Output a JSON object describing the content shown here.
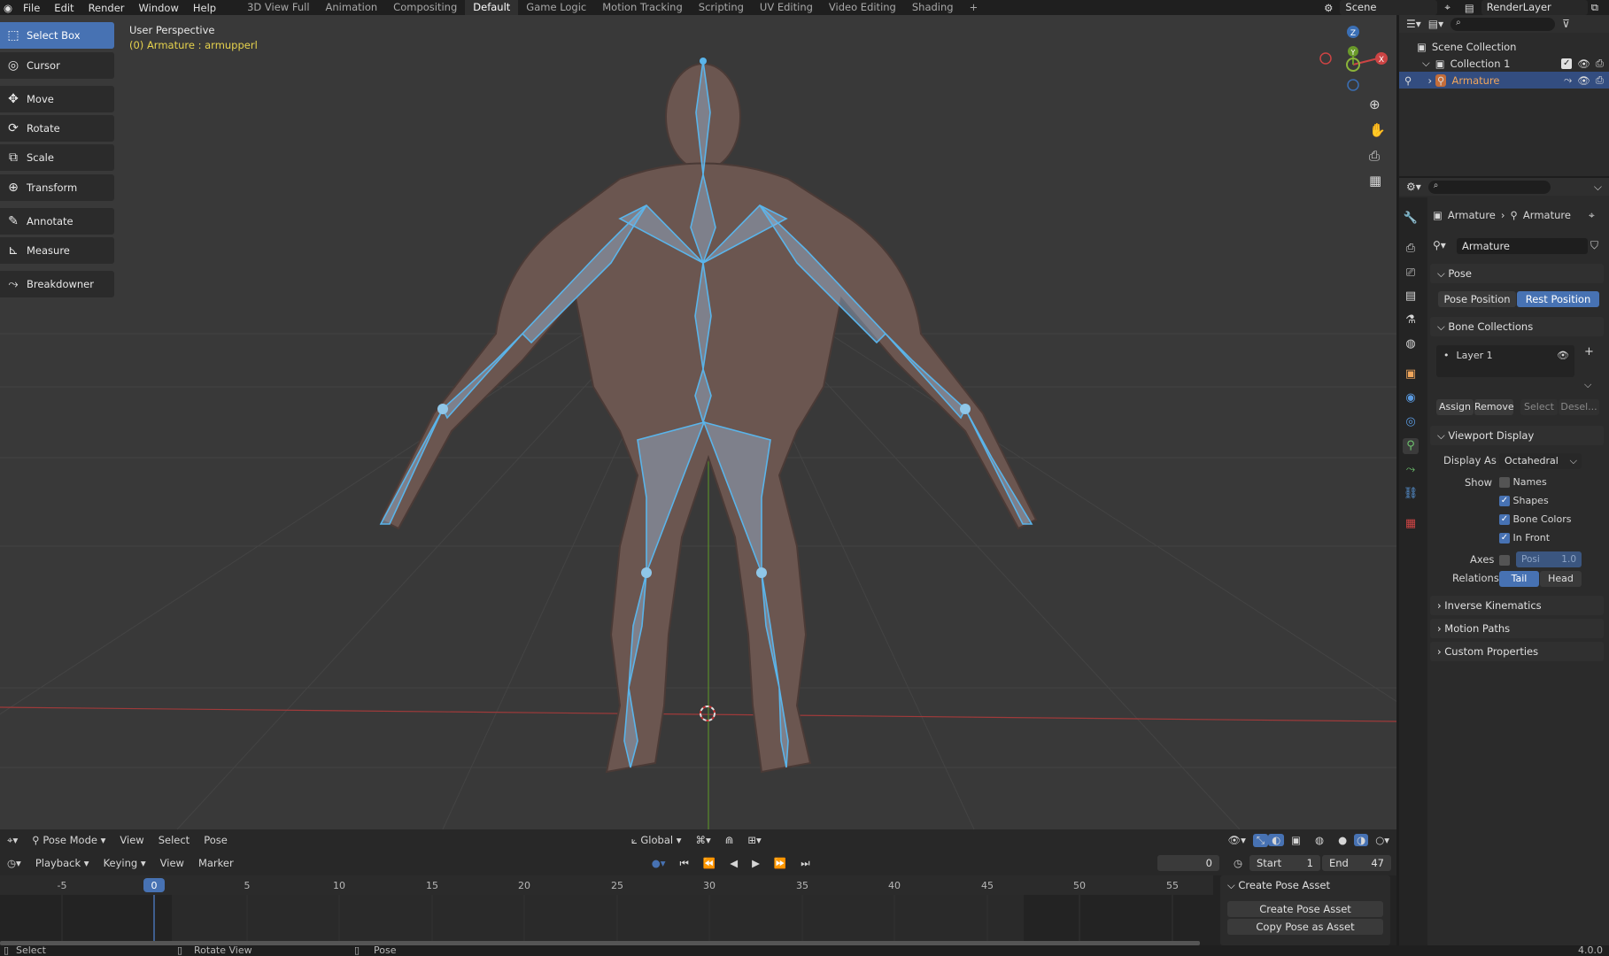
{
  "menu": [
    "File",
    "Edit",
    "Render",
    "Window",
    "Help"
  ],
  "workspaces": [
    "3D View Full",
    "Animation",
    "Compositing",
    "Default",
    "Game Logic",
    "Motion Tracking",
    "Scripting",
    "UV Editing",
    "Video Editing",
    "Shading"
  ],
  "active_workspace": "Default",
  "scene_name": "Scene",
  "view_layer": "RenderLayer",
  "viewport": {
    "perspective": "User Perspective",
    "object_info": "(0) Armature : armupperl",
    "axis_x": "X",
    "axis_y": "Y",
    "axis_z": "Z"
  },
  "tools": [
    {
      "label": "Select Box",
      "icon": "select-box-icon"
    },
    {
      "label": "Cursor",
      "icon": "cursor-icon"
    },
    {
      "label": "Move",
      "icon": "move-icon"
    },
    {
      "label": "Rotate",
      "icon": "rotate-icon"
    },
    {
      "label": "Scale",
      "icon": "scale-icon"
    },
    {
      "label": "Transform",
      "icon": "transform-icon"
    },
    {
      "label": "Annotate",
      "icon": "annotate-icon"
    },
    {
      "label": "Measure",
      "icon": "measure-icon"
    },
    {
      "label": "Breakdowner",
      "icon": "breakdowner-icon"
    }
  ],
  "viewport_header": {
    "mode": "Pose Mode",
    "menus": [
      "View",
      "Select",
      "Pose"
    ],
    "orientation": "Global"
  },
  "timeline": {
    "menus": [
      "Playback",
      "Keying",
      "View",
      "Marker"
    ],
    "current_frame": "0",
    "start_label": "Start",
    "start": "1",
    "end_label": "End",
    "end": "47",
    "ticks": [
      "-5",
      "0",
      "5",
      "10",
      "15",
      "20",
      "25",
      "30",
      "35",
      "40",
      "45",
      "50",
      "55"
    ]
  },
  "pose_asset": {
    "header": "Create Pose Asset",
    "create": "Create Pose Asset",
    "copy": "Copy Pose as Asset"
  },
  "status": {
    "left": "Select",
    "mid": "Rotate View",
    "right": "Pose",
    "version": "4.0.0"
  },
  "outliner": {
    "scene_collection": "Scene Collection",
    "collection": "Collection 1",
    "armature": "Armature"
  },
  "properties": {
    "breadcrumb_obj": "Armature",
    "breadcrumb_data": "Armature",
    "data_name": "Armature",
    "pose_section": "Pose",
    "pose_position": "Pose Position",
    "rest_position": "Rest Position",
    "bone_collections_section": "Bone Collections",
    "layer": "Layer 1",
    "assign": "Assign",
    "remove": "Remove",
    "select": "Select",
    "deselect": "Desel...",
    "viewport_display_section": "Viewport Display",
    "display_as_label": "Display As",
    "display_as": "Octahedral",
    "show_label": "Show",
    "names": "Names",
    "shapes": "Shapes",
    "bone_colors": "Bone Colors",
    "in_front": "In Front",
    "axes_label": "Axes",
    "axes_pos": "Posi",
    "axes_val": "1.0",
    "relations_label": "Relations",
    "tail": "Tail",
    "head": "Head",
    "ik_section": "Inverse Kinematics",
    "motion_paths_section": "Motion Paths",
    "custom_props_section": "Custom Properties"
  }
}
